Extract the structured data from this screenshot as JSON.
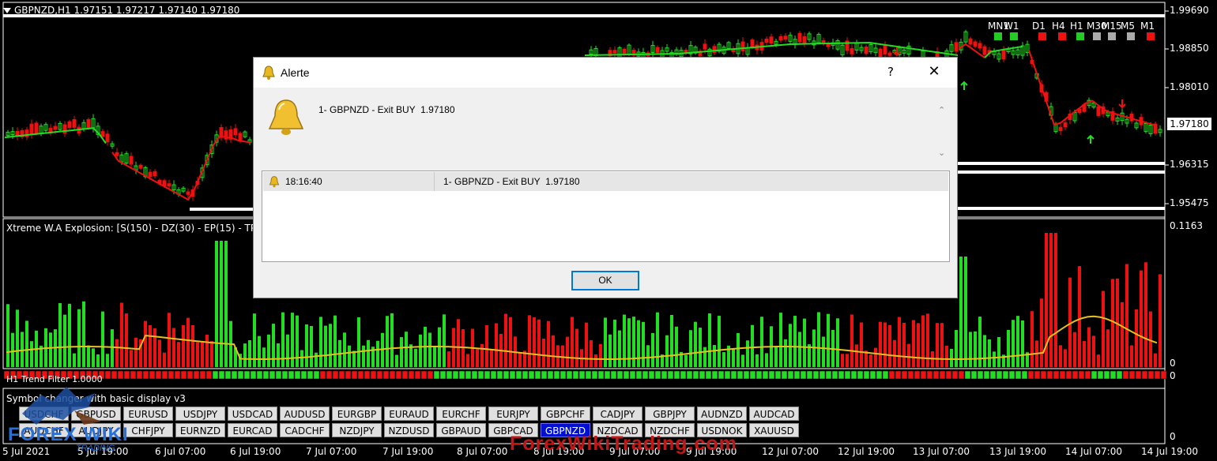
{
  "chart": {
    "header": "GBPNZD,H1  1.97151 1.97217 1.97140 1.97180",
    "timeframes": [
      {
        "label": "MN1",
        "color": "#22cc22"
      },
      {
        "label": "W1",
        "color": "#22cc22"
      },
      {
        "label": "D1",
        "color": "#ee1111"
      },
      {
        "label": "H4",
        "color": "#ee1111"
      },
      {
        "label": "H1",
        "color": "#22cc22"
      },
      {
        "label": "M30",
        "color": "#aaaaaa"
      },
      {
        "label": "M15",
        "color": "#aaaaaa"
      },
      {
        "label": "M5",
        "color": "#aaaaaa"
      },
      {
        "label": "M1",
        "color": "#ee1111"
      }
    ],
    "price_axis": [
      "1.99690",
      "1.98850",
      "1.98010",
      "1.96315",
      "1.95475"
    ],
    "current_price": "1.97180",
    "time_axis": [
      "5 Jul 2021",
      "5 Jul 19:00",
      "6 Jul 07:00",
      "6 Jul 19:00",
      "7 Jul 07:00",
      "7 Jul 19:00",
      "8 Jul 07:00",
      "8 Jul 19:00",
      "9 Jul 07:00",
      "9 Jul 19:00",
      "12 Jul 07:00",
      "12 Jul 19:00",
      "13 Jul 07:00",
      "13 Jul 19:00",
      "14 Jul 07:00",
      "14 Jul 19:00"
    ],
    "bull_color": "#22dd22",
    "bear_color": "#ee1111",
    "signal_color": "#e8c020"
  },
  "indicator": {
    "title": "Xtreme W.A Explosion: [S(150) - DZ(30) - EP(15) - TP(1",
    "max_label": "0.1163",
    "zero_label": "0",
    "sep_label": "0"
  },
  "filter_label": "H1 Trend Filter 1.0000",
  "symbols": {
    "title": "Symbol changer with basic display v3",
    "row1": [
      "USDCHF",
      "GBPUSD",
      "EURUSD",
      "USDJPY",
      "USDCAD",
      "AUDUSD",
      "EURGBP",
      "EURAUD",
      "EURCHF",
      "EURJPY",
      "GBPCHF",
      "CADJPY",
      "GBPJPY",
      "AUDNZD",
      "AUDCAD"
    ],
    "row2": [
      "AUDCHF",
      "AUDJPY",
      "CHFJPY",
      "EURNZD",
      "EURCAD",
      "CADCHF",
      "NZDJPY",
      "NZDUSD",
      "GBPAUD",
      "GBPCAD",
      "GBPNZD",
      "NZDCAD",
      "NZDCHF",
      "USDNOK",
      "XAUUSD"
    ],
    "active": "GBPNZD",
    "zero_label": "0"
  },
  "branding": {
    "logo": "FOREX WIKI",
    "logo_sub": "TRADING",
    "watermark": "ForexWikiTrading.com"
  },
  "dialog": {
    "title": "Alerte",
    "help": "?",
    "close": "✕",
    "message": "1- GBPNZD - Exit BUY  1.97180",
    "row_time": "18:16:40",
    "row_message": "1- GBPNZD - Exit BUY  1.97180",
    "ok_label": "OK"
  }
}
